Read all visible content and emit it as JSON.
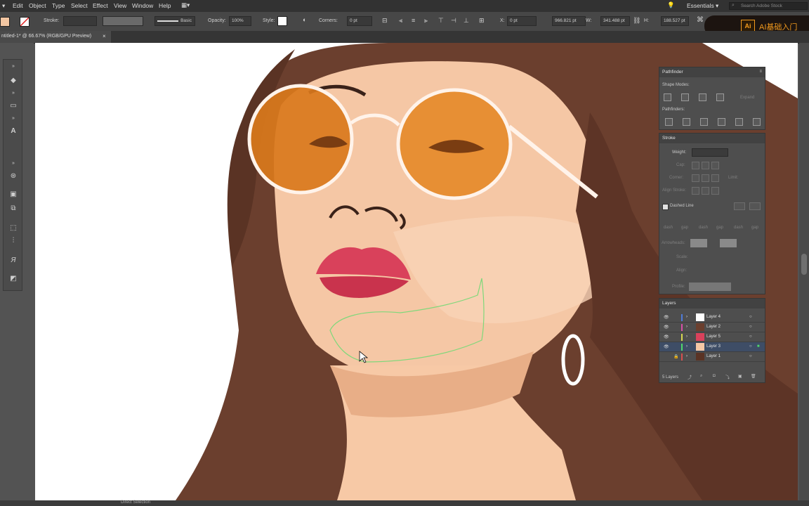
{
  "menu": {
    "items": [
      "Edit",
      "Object",
      "Type",
      "Select",
      "Effect",
      "View",
      "Window",
      "Help"
    ],
    "workspace": "Essentials",
    "search_placeholder": "Search Adobe Stock"
  },
  "control": {
    "stroke_label": "Stroke:",
    "brush_label": "Basic",
    "opacity_label": "Opacity:",
    "opacity_value": "100%",
    "style_label": "Style:",
    "corners_label": "Corners:",
    "corners_value": "0 pt",
    "x_label": "X:",
    "x_value": "0 pt",
    "y_value": "966.821 pt",
    "w_label": "W:",
    "w_value": "341.488 pt",
    "h_label": "H:",
    "h_value": "188.527 pt"
  },
  "document": {
    "tab_title": "ntitled-1* @ 66.67% (RGB/GPU Preview)",
    "tab_close": "×"
  },
  "badge": {
    "logo": "Ai",
    "text": "AI基础入门"
  },
  "pathfinder": {
    "title": "Pathfinder",
    "shape_modes": "Shape Modes:",
    "expand": "Expand",
    "pathfinders": "Pathfinders:"
  },
  "stroke_panel": {
    "title": "Stroke",
    "weight_label": "Weight:",
    "cap": "Cap:",
    "corner": "Corner:",
    "limit": "Limit:",
    "align_stroke": "Align Stroke:",
    "dashed_line": "Dashed Line",
    "dash_fields": [
      "dash",
      "gap",
      "dash",
      "gap",
      "dash",
      "gap"
    ],
    "arrowheads": "Arrowheads:",
    "scale": "Scale:",
    "align": "Align:",
    "profile": "Profile:"
  },
  "layers": {
    "title": "Layers",
    "items": [
      {
        "name": "Layer 4",
        "color": "#4f7bd8",
        "selected": false
      },
      {
        "name": "Layer 2",
        "color": "#d84fa8",
        "selected": false
      },
      {
        "name": "Layer 5",
        "color": "#d8d84f",
        "selected": false
      },
      {
        "name": "Layer 3",
        "color": "#4fd86b",
        "selected": true
      },
      {
        "name": "Layer 1",
        "color": "#d84f4f",
        "selected": false
      }
    ],
    "count": "5 Layers"
  },
  "status": {
    "mode": "Direct Selection"
  },
  "colors": {
    "hair": "#6b3f2e",
    "skin": "#f5c7a5",
    "lens": "#e58a2a",
    "lips": "#d9415b",
    "selection": "#7fd87a"
  }
}
